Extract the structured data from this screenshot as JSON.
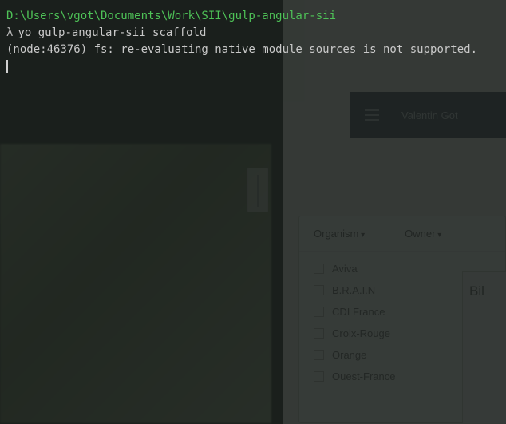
{
  "terminal": {
    "path": "D:\\Users\\vgot\\Documents\\Work\\SII\\gulp-angular-sii",
    "prompt": "λ",
    "command": "yo gulp-angular-sii scaffold",
    "output": "(node:46376) fs: re-evaluating native module sources is not supported."
  },
  "background": {
    "header_user": "Valentin Got",
    "panel": {
      "filter1": "Organism",
      "filter2": "Owner",
      "items": [
        "Aviva",
        "B.R.A.I.N",
        "CDI France",
        "Croix-Rouge",
        "Orange",
        "Ouest-France"
      ]
    },
    "side_label": "Bil"
  }
}
